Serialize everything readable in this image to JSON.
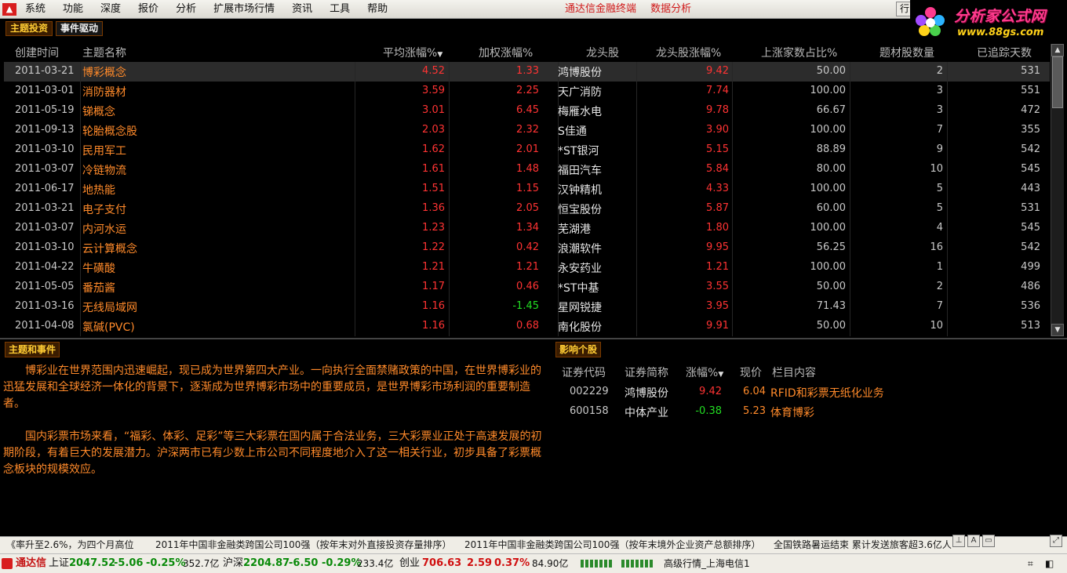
{
  "menu": {
    "items": [
      "系统",
      "功能",
      "深度",
      "报价",
      "分析",
      "扩展市场行情",
      "资讯",
      "工具",
      "帮助"
    ],
    "center": [
      "通达信金融终端",
      "数据分析"
    ],
    "win_btn": "行"
  },
  "brand": {
    "title": "分析家公式网",
    "url": "www.88gs.com"
  },
  "tabs": {
    "active": "主题投资",
    "inactive": "事件驱动"
  },
  "table": {
    "headers": {
      "date": "创建时间",
      "name": "主题名称",
      "avg": "平均涨幅%",
      "wgt": "加权涨幅%",
      "lead": "龙头股",
      "lead_pct": "龙头股涨幅%",
      "ratio": "上涨家数占比%",
      "count": "题材股数量",
      "days": "已追踪天数"
    },
    "rows": [
      {
        "date": "2011-03-21",
        "name": "博彩概念",
        "avg": "4.52",
        "wgt": "1.33",
        "lead": "鸿博股份",
        "lead_pct": "9.42",
        "ratio": "50.00",
        "count": "2",
        "days": "531"
      },
      {
        "date": "2011-03-01",
        "name": "消防器材",
        "avg": "3.59",
        "wgt": "2.25",
        "lead": "天广消防",
        "lead_pct": "7.74",
        "ratio": "100.00",
        "count": "3",
        "days": "551"
      },
      {
        "date": "2011-05-19",
        "name": "锑概念",
        "avg": "3.01",
        "wgt": "6.45",
        "lead": "梅雁水电",
        "lead_pct": "9.78",
        "ratio": "66.67",
        "count": "3",
        "days": "472"
      },
      {
        "date": "2011-09-13",
        "name": "轮胎概念股",
        "avg": "2.03",
        "wgt": "2.32",
        "lead": "S佳通",
        "lead_pct": "3.90",
        "ratio": "100.00",
        "count": "7",
        "days": "355"
      },
      {
        "date": "2011-03-10",
        "name": "民用军工",
        "avg": "1.62",
        "wgt": "2.01",
        "lead": "*ST银河",
        "lead_pct": "5.15",
        "ratio": "88.89",
        "count": "9",
        "days": "542"
      },
      {
        "date": "2011-03-07",
        "name": "冷链物流",
        "avg": "1.61",
        "wgt": "1.48",
        "lead": "福田汽车",
        "lead_pct": "5.84",
        "ratio": "80.00",
        "count": "10",
        "days": "545"
      },
      {
        "date": "2011-06-17",
        "name": "地热能",
        "avg": "1.51",
        "wgt": "1.15",
        "lead": "汉钟精机",
        "lead_pct": "4.33",
        "ratio": "100.00",
        "count": "5",
        "days": "443"
      },
      {
        "date": "2011-03-21",
        "name": "电子支付",
        "avg": "1.36",
        "wgt": "2.05",
        "lead": "恒宝股份",
        "lead_pct": "5.87",
        "ratio": "60.00",
        "count": "5",
        "days": "531"
      },
      {
        "date": "2011-03-07",
        "name": "内河水运",
        "avg": "1.23",
        "wgt": "1.34",
        "lead": "芜湖港",
        "lead_pct": "1.80",
        "ratio": "100.00",
        "count": "4",
        "days": "545"
      },
      {
        "date": "2011-03-10",
        "name": "云计算概念",
        "avg": "1.22",
        "wgt": "0.42",
        "lead": "浪潮软件",
        "lead_pct": "9.95",
        "ratio": "56.25",
        "count": "16",
        "days": "542"
      },
      {
        "date": "2011-04-22",
        "name": "牛磺酸",
        "avg": "1.21",
        "wgt": "1.21",
        "lead": "永安药业",
        "lead_pct": "1.21",
        "ratio": "100.00",
        "count": "1",
        "days": "499"
      },
      {
        "date": "2011-05-05",
        "name": "番茄酱",
        "avg": "1.17",
        "wgt": "0.46",
        "lead": "*ST中基",
        "lead_pct": "3.55",
        "ratio": "50.00",
        "count": "2",
        "days": "486"
      },
      {
        "date": "2011-03-16",
        "name": "无线局域网",
        "avg": "1.16",
        "wgt": "-1.45",
        "lead": "星网锐捷",
        "lead_pct": "3.95",
        "ratio": "71.43",
        "count": "7",
        "days": "536"
      },
      {
        "date": "2011-04-08",
        "name": "氯碱(PVC)",
        "avg": "1.16",
        "wgt": "0.68",
        "lead": "南化股份",
        "lead_pct": "9.91",
        "ratio": "50.00",
        "count": "10",
        "days": "513"
      }
    ]
  },
  "theme_panel": {
    "tab": "主题和事件",
    "paragraphs": [
      "博彩业在世界范围内迅速崛起，现已成为世界第四大产业。一向执行全面禁赌政策的中国，在世界博彩业的迅猛发展和全球经济一体化的背景下，逐渐成为世界博彩市场中的重要成员，是世界博彩市场利润的重要制造者。",
      "国内彩票市场来看，“福彩、体彩、足彩”等三大彩票在国内属于合法业务，三大彩票业正处于高速发展的初期阶段，有着巨大的发展潜力。沪深两市已有少数上市公司不同程度地介入了这一相关行业，初步具备了彩票概念板块的规模效应。"
    ]
  },
  "stock_panel": {
    "tab": "影响个股",
    "headers": {
      "code": "证券代码",
      "name": "证券简称",
      "pct": "涨幅%",
      "price": "现价",
      "content": "栏目内容"
    },
    "rows": [
      {
        "code": "002229",
        "name": "鸿博股份",
        "pct": "9.42",
        "price": "6.04",
        "content": "RFID和彩票无纸化业务"
      },
      {
        "code": "600158",
        "name": "中体产业",
        "pct": "-0.38",
        "price": "5.23",
        "content": "体育博彩"
      }
    ]
  },
  "ticker": {
    "items": [
      "《率升至2.6%，为四个月高位",
      "2011年中国非金融类跨国公司100强（按年末对外直接投资存量排序）",
      "2011年中国非金融类跨国公司100强（按年末境外企业资产总额排序）",
      "全国铁路暑运结束 累计发送旅客超3.6亿人"
    ]
  },
  "status": {
    "app": "通达信",
    "sh_label": "上证",
    "sh_val": "2047.52",
    "sh_chg": "-5.06",
    "sh_pct": "-0.25%",
    "sh_amt": "352.7亿",
    "hs_label": "沪深",
    "hs_val": "2204.87",
    "hs_chg": "-6.50",
    "hs_pct": "-0.29%",
    "hs_amt": "233.4亿",
    "cy_label": "创业",
    "cy_val": "706.63",
    "cy_chg": "2.59",
    "cy_pct": "0.37%",
    "cy_amt": "84.90亿",
    "server": "高级行情_上海电信1"
  }
}
